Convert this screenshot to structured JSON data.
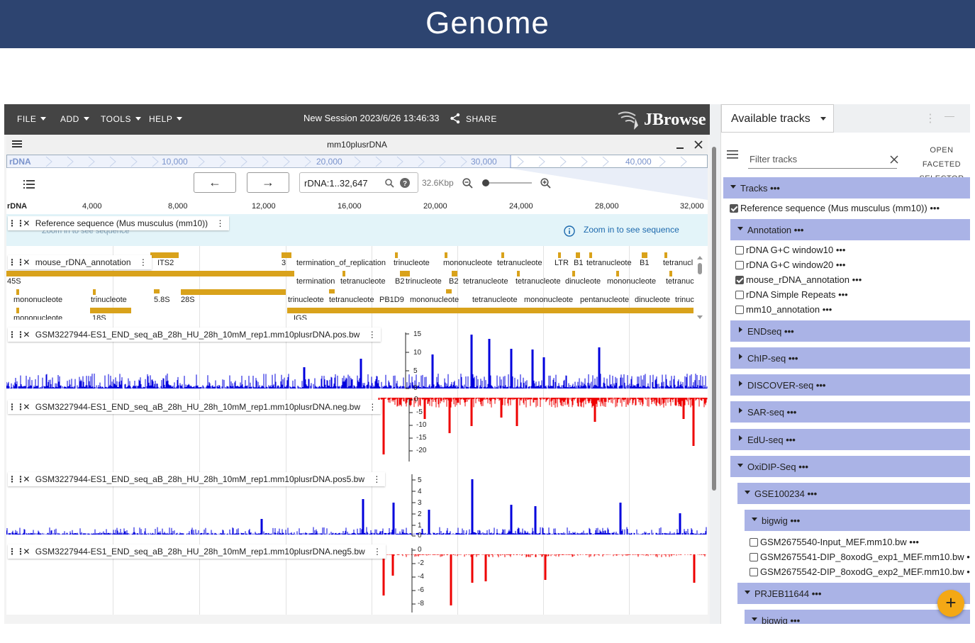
{
  "banner": {
    "title": "Genome"
  },
  "menubar": {
    "items": [
      "FILE",
      "ADD",
      "TOOLS",
      "HELP"
    ],
    "session": "New Session 2023/6/26 13:46:33",
    "share": "SHARE",
    "logo": "JBrowse"
  },
  "view": {
    "assembly": "mm10plusrDNA",
    "overview": {
      "refname": "rDNA",
      "ticks": [
        "10,000",
        "20,000",
        "30,000",
        "40,000"
      ]
    },
    "location": "rDNA:1..32,647",
    "span": "32.6Kbp",
    "ruler": {
      "refname": "rDNA",
      "ticks": [
        "4,000",
        "8,000",
        "12,000",
        "16,000",
        "20,000",
        "24,000",
        "28,000",
        "32,000"
      ]
    }
  },
  "tracks": {
    "refseq": {
      "label": "Reference sequence (Mus musculus (mm10))",
      "hint": "Zoom in to see sequence",
      "underlay": "Zoom in to see sequence"
    },
    "annotation": {
      "label": "mouse_rDNA_annotation",
      "features_row1": [
        "ITS2",
        "3",
        "termination_of_replication",
        "trinucleote",
        "mononucleote",
        "tetranucleote",
        "LTR",
        "B1",
        "tetranucleote",
        "B1",
        "tetranucl"
      ],
      "features_row2": [
        "45S",
        "termination",
        "tetranucleote",
        "B2",
        "trinucleote",
        "B2",
        "tetranucleote",
        "tetranucleote",
        "dinucleote",
        "mononucleote",
        "tetranuc"
      ],
      "features_row3": [
        "mononucleote",
        "trinucleote",
        "5.8S",
        "28S",
        "trinucleote",
        "tetranucleote",
        "PB1D9",
        "mononucleote",
        "tetranucleote",
        "mononucleote",
        "pentanucleote",
        "dinucleote",
        "trinuc"
      ],
      "features_row4": [
        "mononucleote",
        "18S",
        "IGS"
      ]
    },
    "bw1": {
      "label": "GSM3227944-ES1_END_seq_aB_28h_HU_28h_10mM_rep1.mm10plusrDNA.pos.bw",
      "axis": [
        "15",
        "10",
        "5",
        "0"
      ],
      "color": "#0000dd"
    },
    "bw2": {
      "label": "GSM3227944-ES1_END_seq_aB_28h_HU_28h_10mM_rep1.mm10plusrDNA.neg.bw",
      "axis": [
        "0",
        "-5",
        "-10",
        "-15",
        "-20"
      ],
      "color": "#ee0000"
    },
    "bw3": {
      "label": "GSM3227944-ES1_END_seq_aB_28h_HU_28h_10mM_rep1.mm10plusrDNA.pos5.bw",
      "axis": [
        "5",
        "4",
        "3",
        "2",
        "1",
        "0"
      ],
      "color": "#0000dd"
    },
    "bw4": {
      "label": "GSM3227944-ES1_END_seq_aB_28h_HU_28h_10mM_rep1.mm10plusrDNA.neg5.bw",
      "axis": [
        "0",
        "-2",
        "-4",
        "-6",
        "-8"
      ],
      "color": "#ee0000"
    }
  },
  "selector": {
    "title": "Available tracks",
    "filter_placeholder": "Filter tracks",
    "facet_line1": "OPEN FACETED",
    "facet_line2": "SELECTOR",
    "tracks_cat": "Tracks",
    "refseq": "Reference sequence (Mus musculus (mm10))",
    "annotation_cat": "Annotation",
    "annotation_items": [
      "rDNA G+C window10",
      "rDNA G+C window20",
      "mouse_rDNA_annotation",
      "rDNA Simple Repeats",
      "mm10_annotation"
    ],
    "categories": [
      "ENDseq",
      "ChIP-seq",
      "DISCOVER-seq",
      "SAR-seq",
      "EdU-seq"
    ],
    "oxidip_cat": "OxiDIP-Seq",
    "gse_cat": "GSE100234",
    "bigwig_cat": "bigwig",
    "bigwig_items": [
      "GSM2675540-Input_MEF.mm10.bw",
      "GSM2675541-DIP_8oxodG_exp1_MEF.mm10.bw",
      "GSM2675542-DIP_8oxodG_exp2_MEF.mm10.bw"
    ],
    "prjeb_cat": "PRJEB11644",
    "bigwig2_cat": "bigwig",
    "more": "•••"
  }
}
